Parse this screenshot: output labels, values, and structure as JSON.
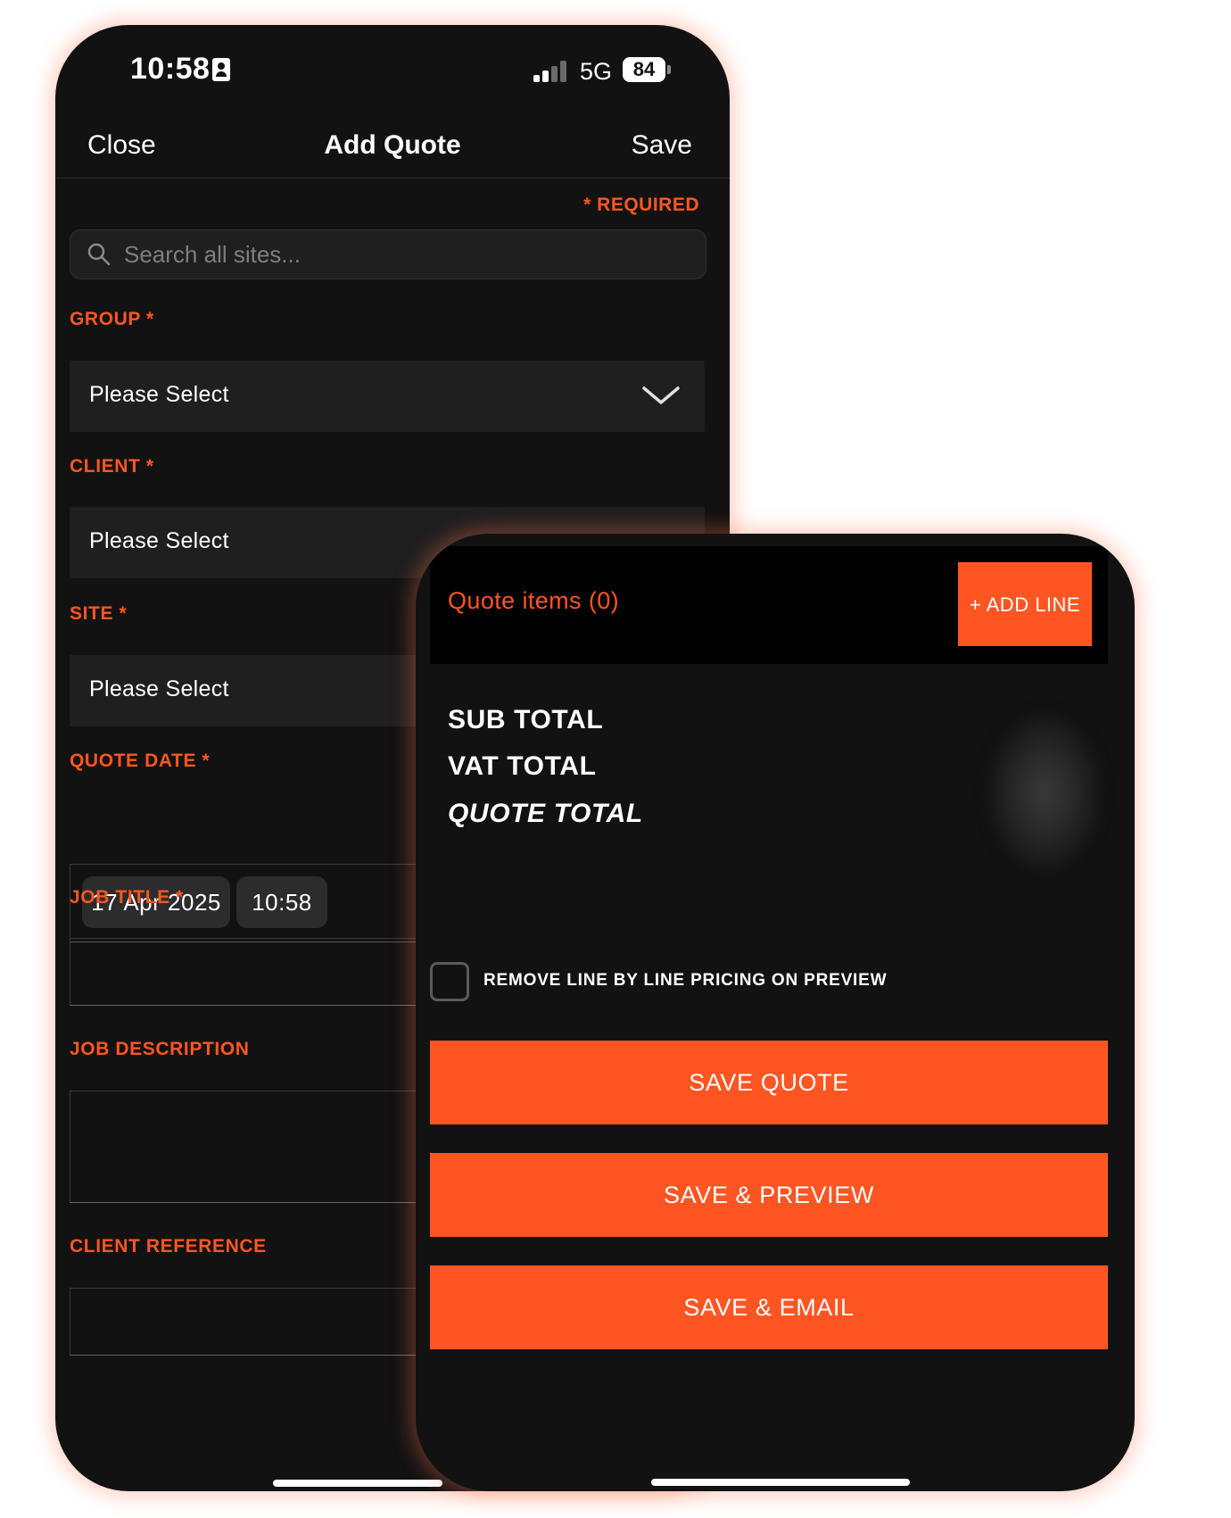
{
  "status_bar": {
    "time": "10:58",
    "network": "5G",
    "battery": "84",
    "colors": {
      "signal_active": "#ffffff",
      "signal_inactive": "#6a6a6a"
    }
  },
  "nav": {
    "close_label": "Close",
    "title": "Add Quote",
    "save_label": "Save"
  },
  "form": {
    "required_note": "* REQUIRED",
    "search": {
      "placeholder": "Search all sites..."
    },
    "group": {
      "label": "GROUP *",
      "value": "Please Select"
    },
    "client": {
      "label": "CLIENT *",
      "value": "Please Select"
    },
    "site": {
      "label": "SITE *",
      "value": "Please Select"
    },
    "quote_date": {
      "label": "QUOTE DATE *",
      "date": "17 Apr 2025",
      "time": "10:58"
    },
    "job_title": {
      "label": "JOB TITLE *",
      "value": ""
    },
    "job_description": {
      "label": "JOB DESCRIPTION",
      "value": ""
    },
    "client_reference": {
      "label": "CLIENT REFERENCE",
      "value": ""
    }
  },
  "quote_panel": {
    "items_title": "Quote items (0)",
    "add_line_label": "+ ADD LINE",
    "sub_total_label": "SUB TOTAL",
    "vat_total_label": "VAT TOTAL",
    "quote_total_label": "QUOTE TOTAL",
    "remove_pricing_label": "REMOVE LINE BY LINE PRICING ON PREVIEW",
    "remove_pricing_checked": false,
    "save_quote_label": "SAVE QUOTE",
    "save_preview_label": "SAVE & PREVIEW",
    "save_email_label": "SAVE & EMAIL"
  },
  "theme": {
    "accent": "#ff5522",
    "background": "#121212",
    "field_bg": "#1f1f1f"
  }
}
